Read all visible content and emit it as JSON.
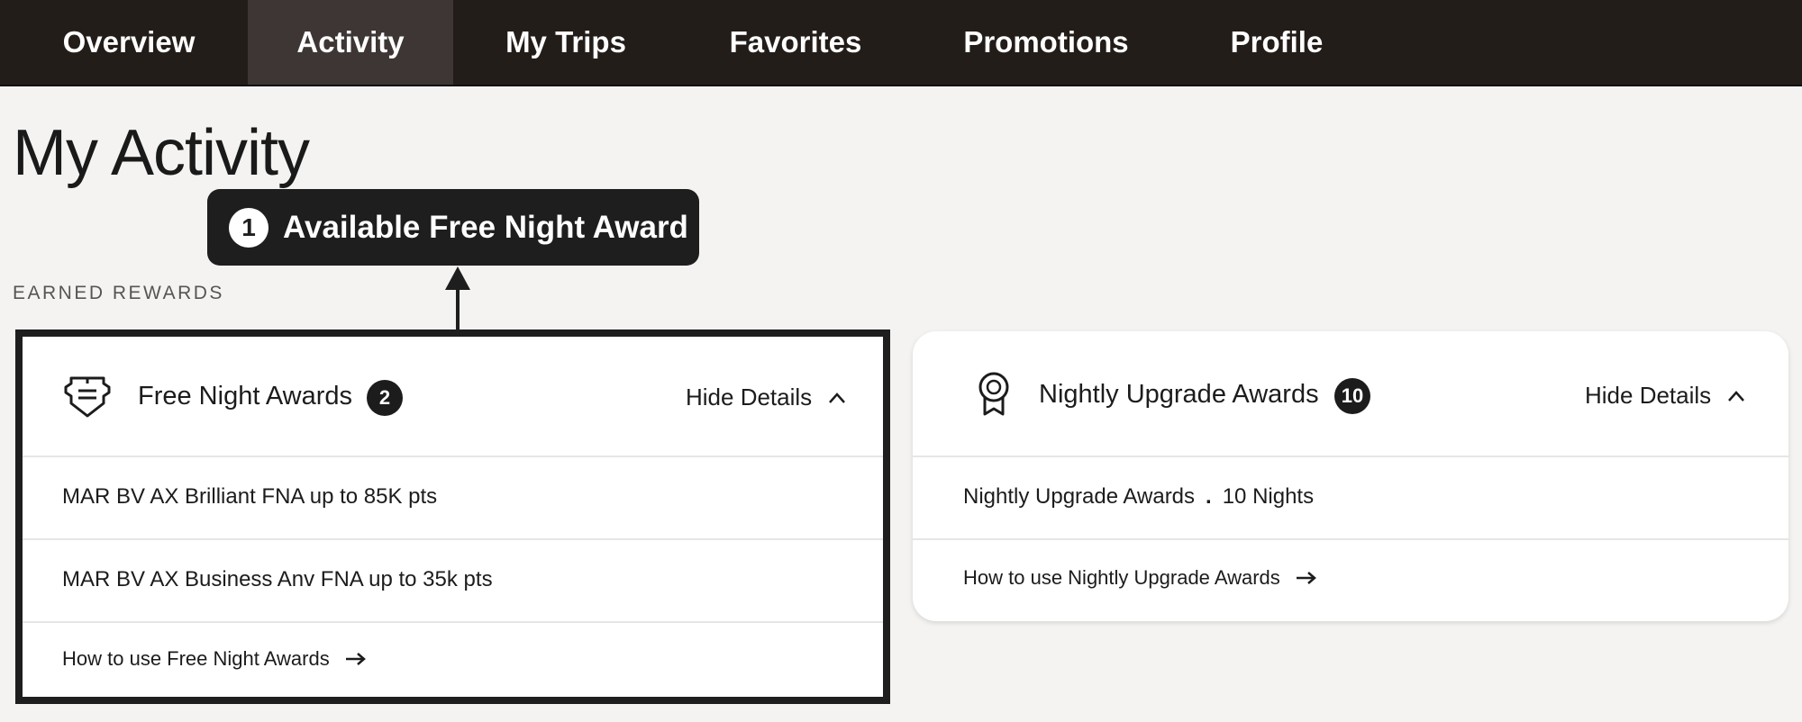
{
  "nav": {
    "tabs": [
      {
        "label": "Overview",
        "active": false
      },
      {
        "label": "Activity",
        "active": true
      },
      {
        "label": "My Trips",
        "active": false
      },
      {
        "label": "Favorites",
        "active": false
      },
      {
        "label": "Promotions",
        "active": false
      },
      {
        "label": "Profile",
        "active": false
      }
    ]
  },
  "page": {
    "title": "My Activity",
    "section_label": "EARNED REWARDS"
  },
  "callout": {
    "number": "1",
    "text": "Available Free Night Award"
  },
  "free_night_card": {
    "icon": "certificate-icon",
    "title": "Free Night Awards",
    "count": "2",
    "hide_details": "Hide Details",
    "items": [
      "MAR BV AX Brilliant FNA up to 85K pts",
      "MAR BV AX Business Anv FNA up to 35k pts"
    ],
    "link": "How to use Free Night Awards"
  },
  "upgrade_card": {
    "icon": "award-ribbon-icon",
    "title": "Nightly Upgrade Awards",
    "count": "10",
    "hide_details": "Hide Details",
    "item_name": "Nightly Upgrade Awards",
    "item_separator": ".",
    "item_value": "10 Nights",
    "link": "How to use Nightly Upgrade Awards"
  },
  "colors": {
    "nav_bg": "#231d1a",
    "nav_active": "#3d3634",
    "page_bg": "#f4f3f2",
    "callout_bg": "#1e1e1e"
  }
}
